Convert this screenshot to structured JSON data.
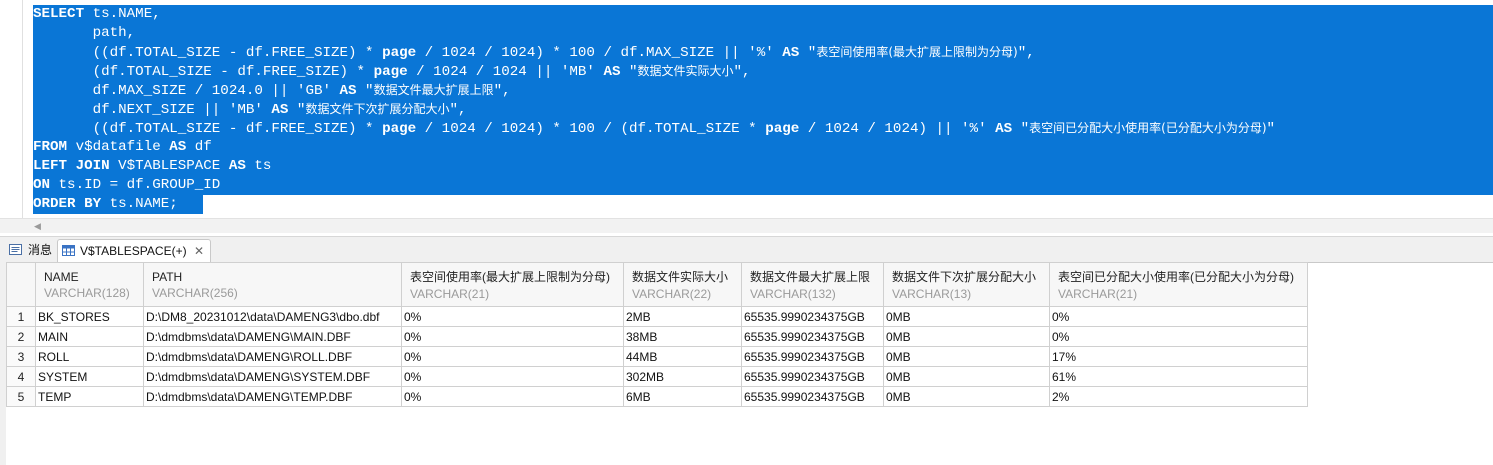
{
  "sql": {
    "line1": {
      "kw": "SELECT",
      "rest": " ts.NAME,"
    },
    "line2": "       path,",
    "line3": {
      "a": "       ((df.TOTAL_SIZE - df.FREE_SIZE) * ",
      "kw1": "page",
      "b": " / 1024 / 1024) * 100 / df.MAX_SIZE || '%' ",
      "kw2": "AS",
      "c": " \"",
      "cn": "表空间使用率(最大扩展上限制为分母)",
      "d": "\","
    },
    "line4": {
      "a": "       (df.TOTAL_SIZE - df.FREE_SIZE) * ",
      "kw1": "page",
      "b": " / 1024 / 1024 || 'MB' ",
      "kw2": "AS",
      "c": " \"",
      "cn": "数据文件实际大小",
      "d": "\","
    },
    "line5": {
      "a": "       df.MAX_SIZE / 1024.0 || 'GB' ",
      "kw2": "AS",
      "c": " \"",
      "cn": "数据文件最大扩展上限",
      "d": "\","
    },
    "line6": {
      "a": "       df.NEXT_SIZE || 'MB' ",
      "kw2": "AS",
      "c": " \"",
      "cn": "数据文件下次扩展分配大小",
      "d": "\","
    },
    "line7": {
      "a": "       ((df.TOTAL_SIZE - df.FREE_SIZE) * ",
      "kw1": "page",
      "b": " / 1024 / 1024) * 100 / (df.TOTAL_SIZE * ",
      "kw3": "page",
      "b2": " / 1024 / 1024) || '%' ",
      "kw2": "AS",
      "c": " \"",
      "cn": "表空间已分配大小使用率(已分配大小为分母)",
      "d": "\""
    },
    "line8": {
      "kw": "FROM",
      "rest": " v$datafile ",
      "kw2": "AS",
      "rest2": " df"
    },
    "line9": {
      "kw": "LEFT JOIN",
      "rest": " V$TABLESPACE ",
      "kw2": "AS",
      "rest2": " ts"
    },
    "line10": {
      "kw": "ON",
      "rest": " ts.ID = df.GROUP_ID"
    },
    "line11": {
      "kw": "ORDER BY",
      "rest": " ts.NAME;"
    }
  },
  "tabs": {
    "messages": "消息",
    "result": "V$TABLESPACE(+)"
  },
  "grid": {
    "columns": [
      {
        "name": "NAME",
        "type": "VARCHAR(128)"
      },
      {
        "name": "PATH",
        "type": "VARCHAR(256)"
      },
      {
        "name": "表空间使用率(最大扩展上限制为分母)",
        "type": "VARCHAR(21)"
      },
      {
        "name": "数据文件实际大小",
        "type": "VARCHAR(22)"
      },
      {
        "name": "数据文件最大扩展上限",
        "type": "VARCHAR(132)"
      },
      {
        "name": "数据文件下次扩展分配大小",
        "type": "VARCHAR(13)"
      },
      {
        "name": "表空间已分配大小使用率(已分配大小为分母)",
        "type": "VARCHAR(21)"
      }
    ],
    "rows": [
      {
        "num": "1",
        "cells": [
          "BK_STORES",
          "D:\\DM8_20231012\\data\\DAMENG3\\dbo.dbf",
          "0%",
          "2MB",
          "65535.9990234375GB",
          "0MB",
          "0%"
        ]
      },
      {
        "num": "2",
        "cells": [
          "MAIN",
          "D:\\dmdbms\\data\\DAMENG\\MAIN.DBF",
          "0%",
          "38MB",
          "65535.9990234375GB",
          "0MB",
          "0%"
        ]
      },
      {
        "num": "3",
        "cells": [
          "ROLL",
          "D:\\dmdbms\\data\\DAMENG\\ROLL.DBF",
          "0%",
          "44MB",
          "65535.9990234375GB",
          "0MB",
          "17%"
        ]
      },
      {
        "num": "4",
        "cells": [
          "SYSTEM",
          "D:\\dmdbms\\data\\DAMENG\\SYSTEM.DBF",
          "0%",
          "302MB",
          "65535.9990234375GB",
          "0MB",
          "61%"
        ]
      },
      {
        "num": "5",
        "cells": [
          "TEMP",
          "D:\\dmdbms\\data\\DAMENG\\TEMP.DBF",
          "0%",
          "6MB",
          "65535.9990234375GB",
          "0MB",
          "2%"
        ]
      }
    ]
  }
}
